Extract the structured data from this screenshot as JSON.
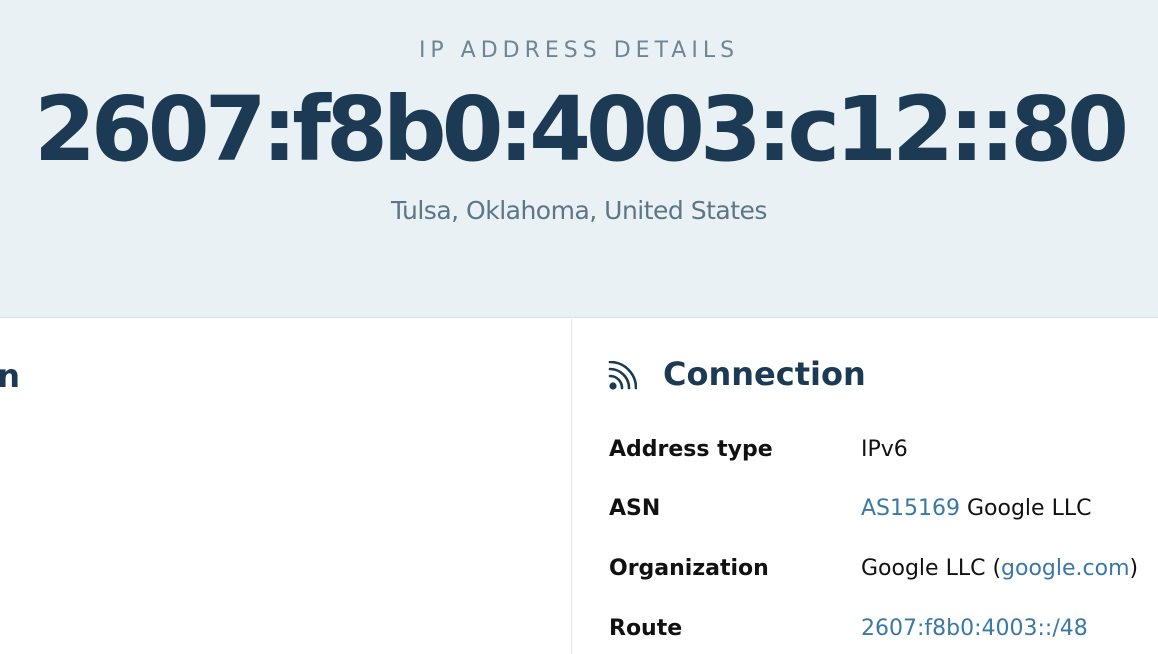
{
  "hero": {
    "label": "IP ADDRESS DETAILS",
    "ip": "2607:f8b0:4003:c12::80",
    "location": "Tulsa, Oklahoma, United States"
  },
  "left_panel": {
    "heading_fragment": "n"
  },
  "connection": {
    "icon": "rss-feed-icon",
    "heading": "Connection",
    "rows": [
      {
        "label": "Address type",
        "value": "IPv6"
      },
      {
        "label": "ASN",
        "link": "AS15169",
        "value": " Google LLC"
      },
      {
        "label": "Organization",
        "value_prefix": "Google LLC (",
        "link": "google.com",
        "value_suffix": ")"
      },
      {
        "label": "Route",
        "link": "2607:f8b0:4003::/48"
      }
    ]
  },
  "colors": {
    "hero_bg": "#e9f1f5",
    "heading": "#1c3a53",
    "muted": "#6f8596",
    "link": "#3a78a6"
  }
}
